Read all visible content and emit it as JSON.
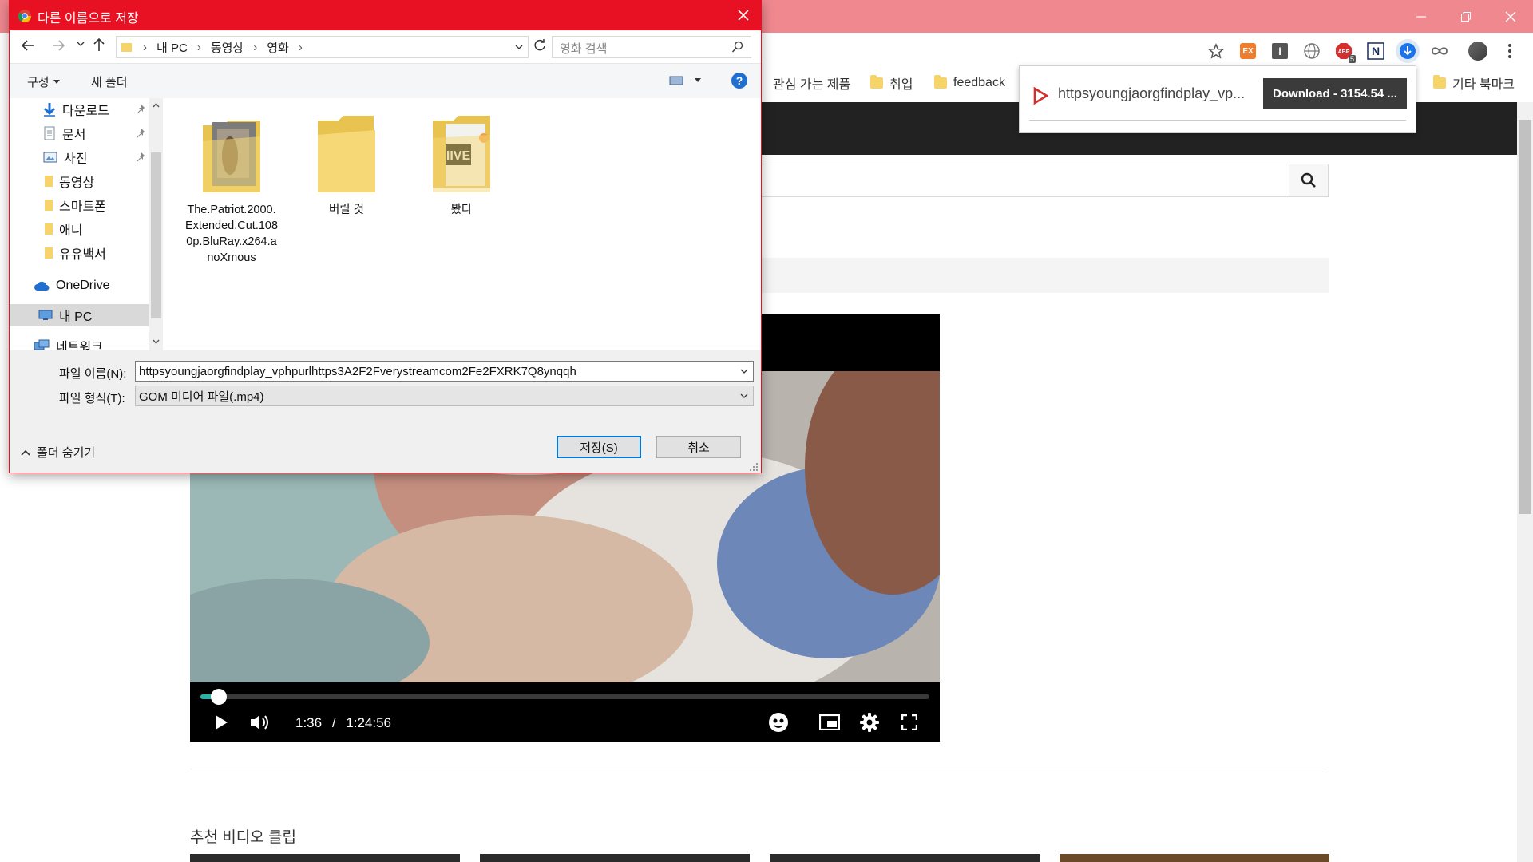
{
  "browser": {
    "bookmarks": [
      {
        "label": "관심 가는 제품"
      },
      {
        "label": "취업"
      },
      {
        "label": "feedback"
      },
      {
        "label": "기타 북마크"
      }
    ],
    "extensions": {
      "abp_badge": "5",
      "ex_label": "EX"
    },
    "download_bubble": {
      "filename": "httpsyoungjaorgfindplay_vp...",
      "button_label": "Download - 3154.54 ..."
    }
  },
  "page": {
    "video": {
      "current_time": "1:36",
      "separator": "/",
      "duration": "1:24:56",
      "progress_fraction": 0.019
    },
    "recommended_title": "추천 비디오 클립"
  },
  "dialog": {
    "title": "다른 이름으로 저장",
    "breadcrumb": [
      "내 PC",
      "동영상",
      "영화"
    ],
    "search_placeholder": "영화 검색",
    "commands": {
      "organize": "구성",
      "new_folder": "새 폴더"
    },
    "nav_items": [
      {
        "label": "다운로드"
      },
      {
        "label": "문서"
      },
      {
        "label": "사진"
      },
      {
        "label": "동영상"
      },
      {
        "label": "스마트폰"
      },
      {
        "label": "애니"
      },
      {
        "label": "유유백서"
      },
      {
        "label": "OneDrive"
      },
      {
        "label": "내 PC"
      },
      {
        "label": "네트워크"
      }
    ],
    "files": [
      {
        "label": "The.Patriot.2000.Extended.Cut.1080p.BluRay.x264.anoXmous"
      },
      {
        "label": "버릴 것"
      },
      {
        "label": "봤다"
      }
    ],
    "filename_label": "파일 이름(N):",
    "filename_value": "httpsyoungjaorgfindplay_vphpurlhttps3A2F2Fverystreamcom2Fe2FXRK7Q8ynqqh",
    "filetype_label": "파일 형식(T):",
    "filetype_value": "GOM 미디어 파일(.mp4)",
    "hide_folders": "폴더 숨기기",
    "save_button": "저장(S)",
    "cancel_button": "취소"
  },
  "colors": {
    "titlebar": "#f08890",
    "dialog_accent": "#e81123",
    "seek_fill": "#2ab3a6",
    "download_arrow": "#1a73e8"
  }
}
